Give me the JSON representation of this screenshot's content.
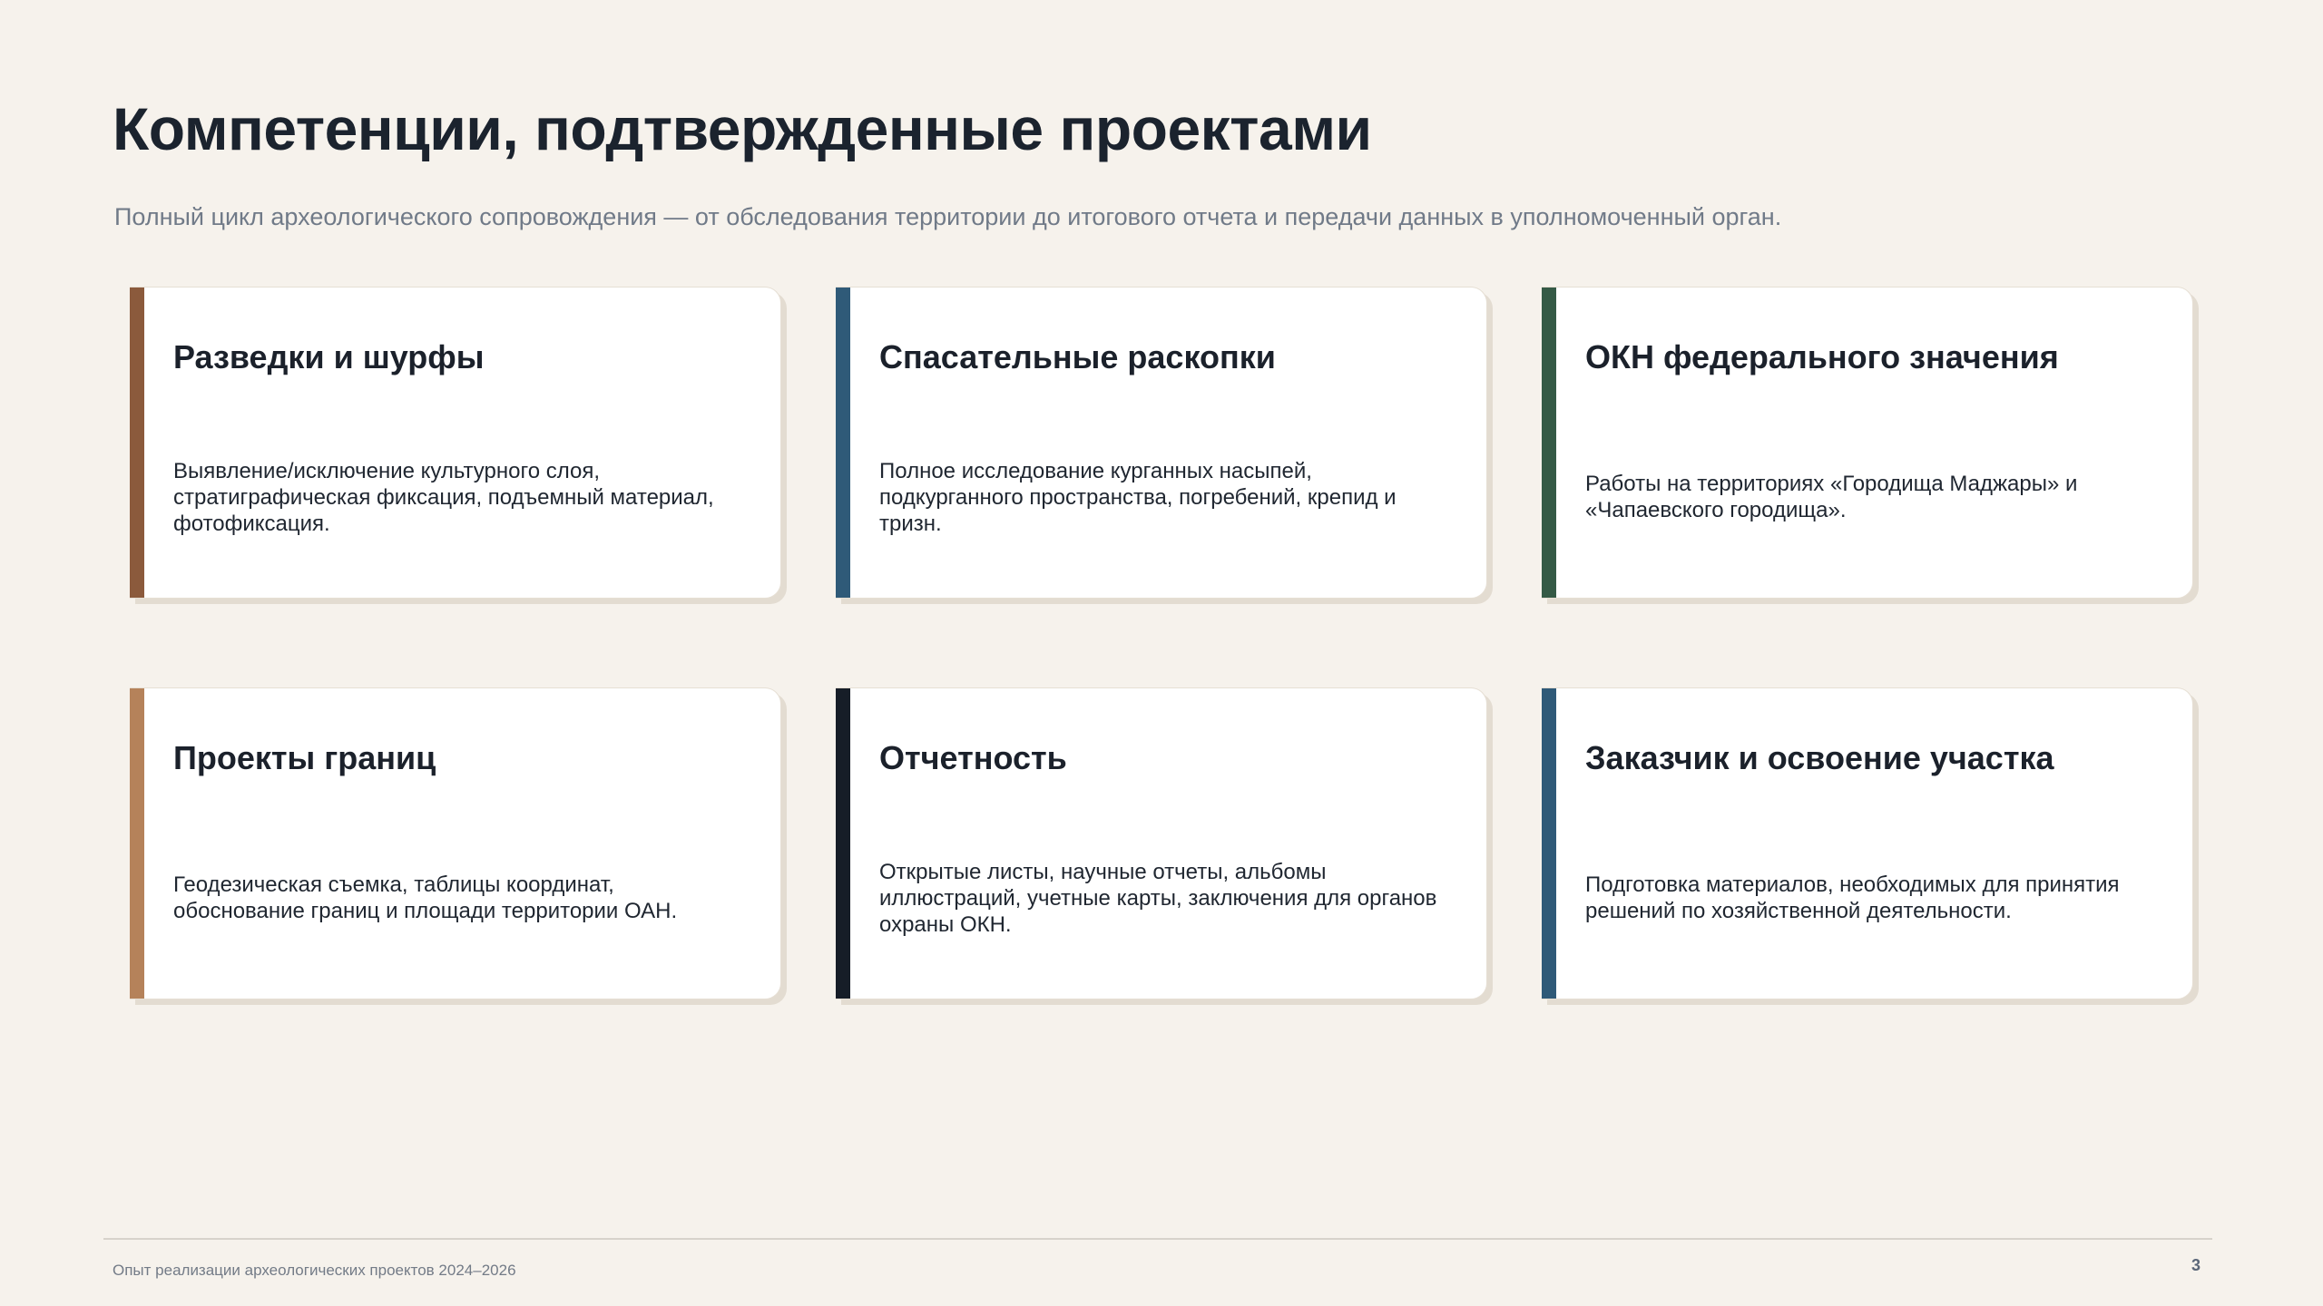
{
  "slide": {
    "title": "Компетенции, подтвержденные проектами",
    "subtitle": "Полный цикл археологического сопровождения — от обследования территории до итогового отчета и передачи данных в уполномоченный орган."
  },
  "cards": [
    {
      "title": "Разведки и шурфы",
      "description": "Выявление/исключение культурного слоя, стратиграфическая фиксация, подъемный материал, фотофиксация.",
      "accent_color": "#8b5a3c"
    },
    {
      "title": "Спасательные раскопки",
      "description": "Полное исследование курганных насыпей, подкурганного пространства, погребений, крепид и тризн.",
      "accent_color": "#2f5a78"
    },
    {
      "title": "ОКН федерального значения",
      "description": "Работы на территориях «Городища Маджары» и «Чапаевского городища».",
      "accent_color": "#355a46"
    },
    {
      "title": "Проекты границ",
      "description": "Геодезическая съемка, таблицы координат, обоснование границ и площади территории ОАН.",
      "accent_color": "#b5825a"
    },
    {
      "title": "Отчетность",
      "description": "Открытые листы, научные отчеты, альбомы иллюстраций, учетные карты, заключения для органов охраны ОКН.",
      "accent_color": "#161d27"
    },
    {
      "title": "Заказчик и освоение участка",
      "description": "Подготовка материалов, необходимых для принятия решений по хозяйственной деятельности.",
      "accent_color": "#2f5a78"
    }
  ],
  "footer": {
    "text": "Опыт реализации археологических проектов 2024–2026",
    "page_number": "3"
  },
  "colors": {
    "background": "#f6f2ec",
    "title": "#1b232e",
    "subtitle": "#707a88"
  }
}
